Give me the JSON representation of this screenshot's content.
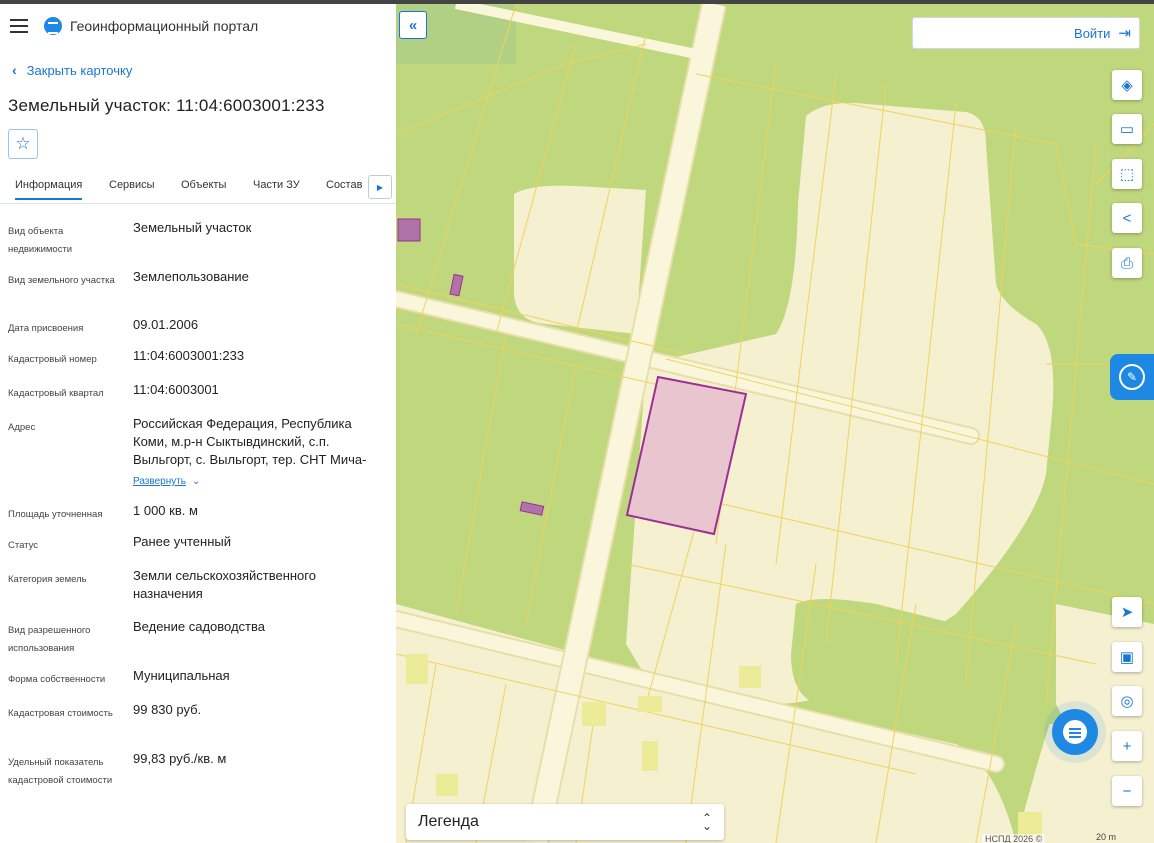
{
  "app": {
    "title": "Геоинформационный портал"
  },
  "card": {
    "back_label": "Закрыть карточку",
    "title": "Земельный участок: 11:04:6003001:233"
  },
  "tabs": [
    {
      "label": "Информация"
    },
    {
      "label": "Сервисы"
    },
    {
      "label": "Объекты"
    },
    {
      "label": "Части ЗУ"
    },
    {
      "label": "Состав"
    }
  ],
  "properties": [
    {
      "label": "Вид объекта недвижимости",
      "value": "Земельный участок"
    },
    {
      "label": "Вид земельного участка",
      "value": "Землепользование"
    },
    {
      "label": "Дата присвоения",
      "value": "09.01.2006"
    },
    {
      "label": "Кадастровый номер",
      "value": "11:04:6003001:233"
    },
    {
      "label": "Кадастровый квартал",
      "value": "11:04:6003001"
    },
    {
      "label": "Адрес",
      "value": "Российская Федерация, Республика Коми, м.р-н Сыктывдинский, с.п. Выльгорт, с. Выльгорт, тер. СНТ Мича-",
      "expand": "Развернуть"
    },
    {
      "label": "Площадь уточненная",
      "value": "1 000 кв. м"
    },
    {
      "label": "Статус",
      "value": "Ранее учтенный"
    },
    {
      "label": "Категория земель",
      "value": "Земли сельскохозяйственного назначения"
    },
    {
      "label": "Вид разрешенного использования",
      "value": "Ведение садоводства"
    },
    {
      "label": "Форма собственности",
      "value": "Муниципальная"
    },
    {
      "label": "Кадастровая стоимость",
      "value": "99 830 руб."
    },
    {
      "label": "Удельный показатель кадастровой стоимости",
      "value": "99,83 руб./кв. м"
    }
  ],
  "map": {
    "login_label": "Войти",
    "legend_label": "Легенда",
    "attribution": "НСПД 2026 ©",
    "scale_label": "20 m",
    "tool_icons": [
      "layers-icon",
      "ruler-icon",
      "select-area-icon",
      "share-icon",
      "print-icon"
    ],
    "nav_icons": [
      "locate-icon",
      "minimap-icon",
      "search-location-icon",
      "zoom-in-icon",
      "zoom-out-icon"
    ],
    "colors": {
      "field": "#bfd77d",
      "parcel_ground": "#f5f0d0",
      "road": "#faf6dc",
      "parcel_line": "#efd35c",
      "selected_fill": "#e9c6cf",
      "selected_stroke": "#9c2f95",
      "accent": "#1976d2"
    }
  }
}
